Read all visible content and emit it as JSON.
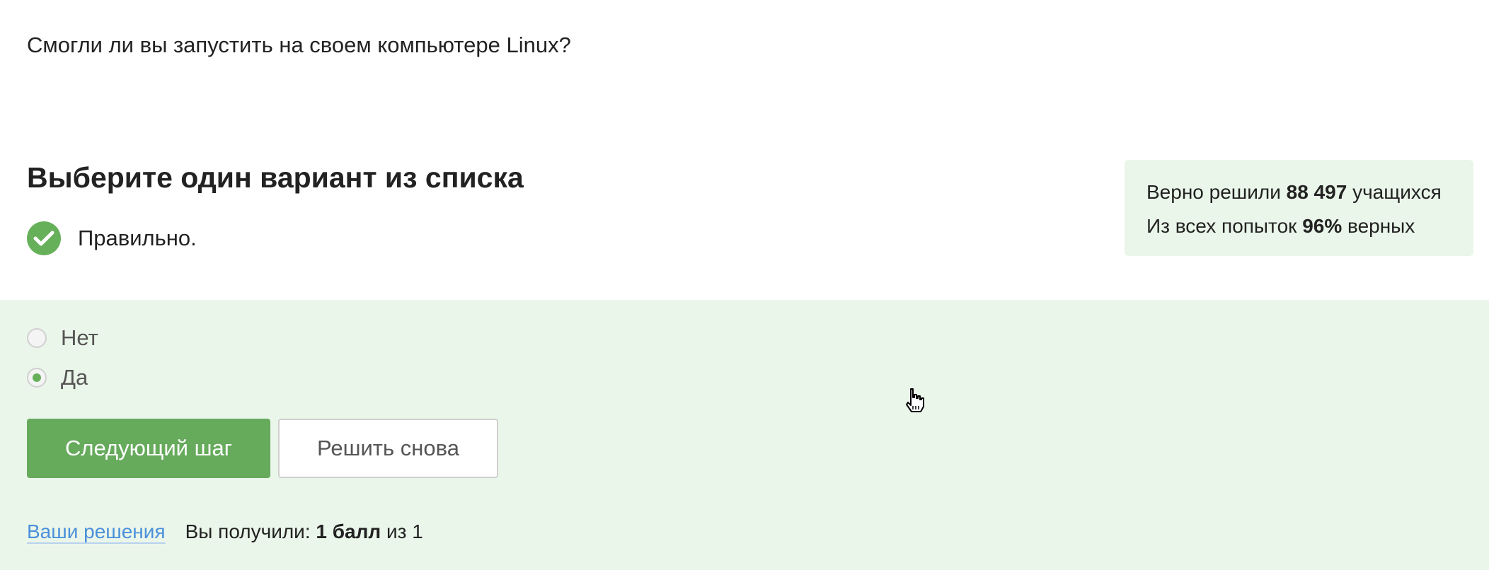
{
  "question": {
    "text": "Смогли ли вы запустить на своем компьютере Linux?"
  },
  "quiz": {
    "title": "Выберите один вариант из списка",
    "result_text": "Правильно.",
    "result_icon": "check-circle-icon",
    "options": [
      {
        "label": "Нет",
        "selected": false
      },
      {
        "label": "Да",
        "selected": true
      }
    ]
  },
  "stats": {
    "line1_prefix": "Верно решили",
    "line1_count": "88 497",
    "line1_suffix": "учащихся",
    "line2_prefix": "Из всех попыток",
    "line2_percent": "96%",
    "line2_suffix": "верных"
  },
  "buttons": {
    "next_label": "Следующий шаг",
    "retry_label": "Решить снова"
  },
  "footer": {
    "solutions_link": "Ваши решения",
    "score_prefix": "Вы получили:",
    "score_value": "1 балл",
    "score_suffix": "из 1"
  },
  "colors": {
    "accent_green": "#66aa5c",
    "panel_bg": "#ebf6ea",
    "link_blue": "#4a90d9"
  }
}
